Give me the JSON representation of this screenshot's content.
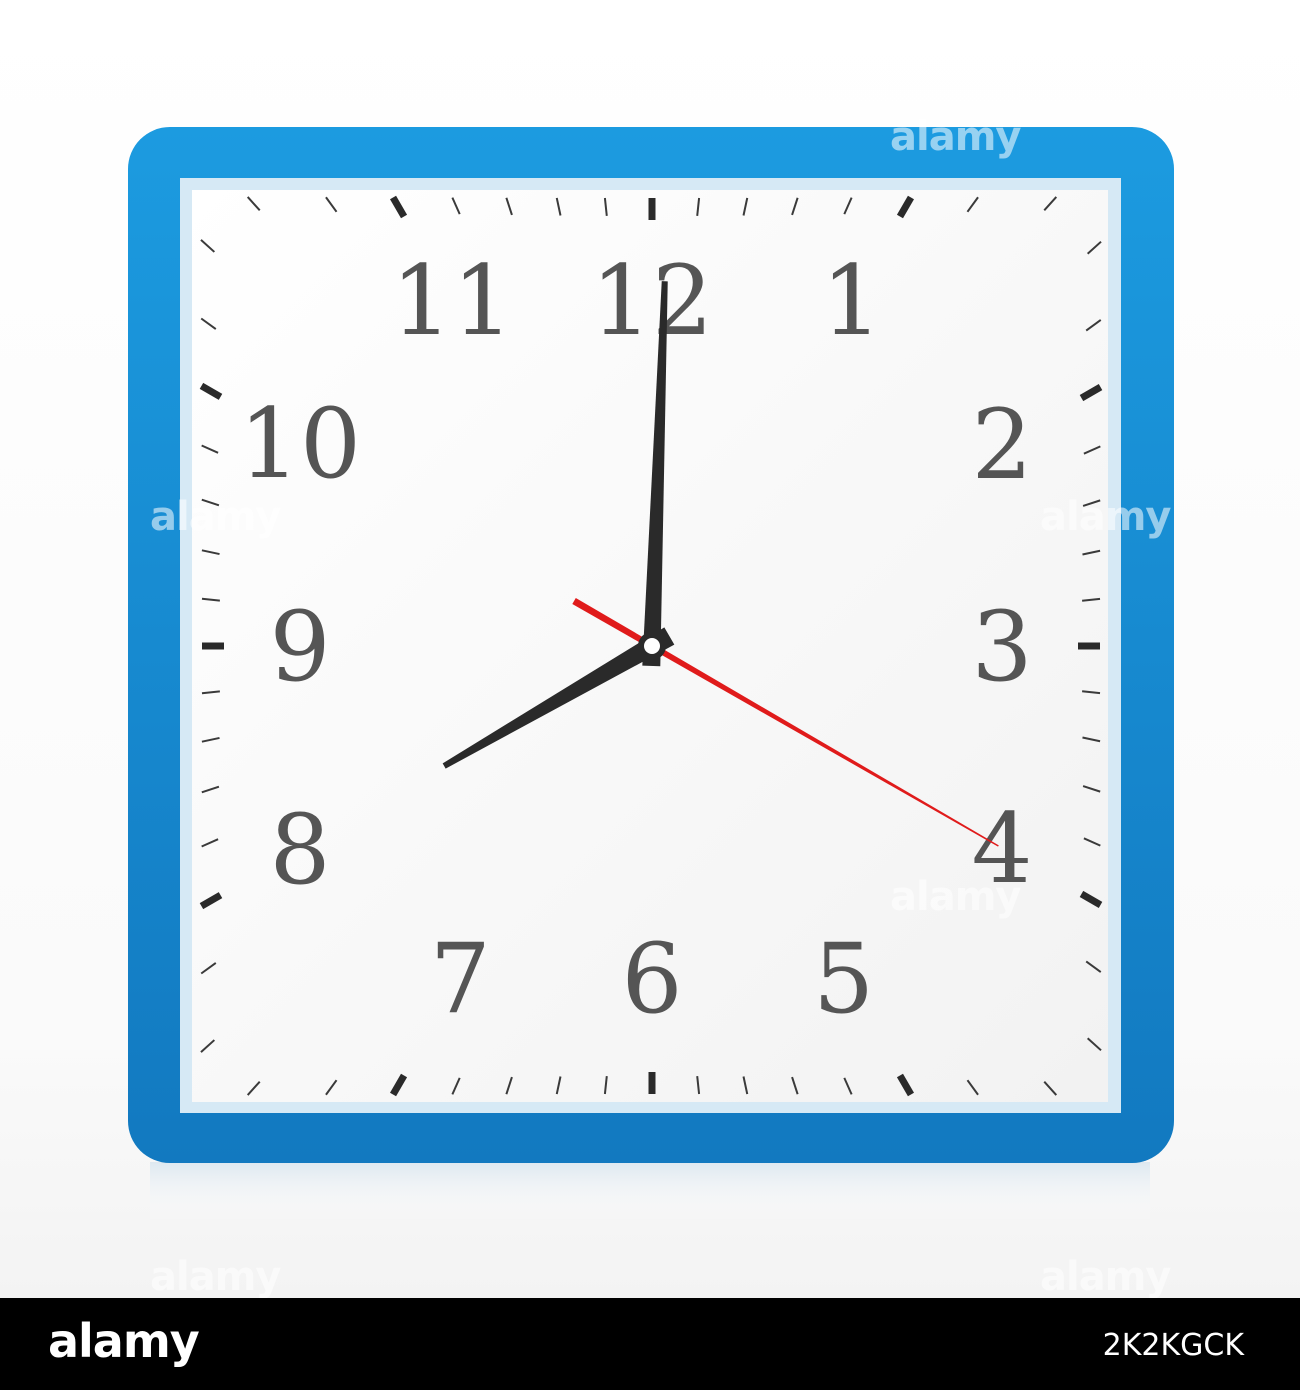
{
  "clock": {
    "numerals": [
      "12",
      "1",
      "2",
      "3",
      "4",
      "5",
      "6",
      "7",
      "8",
      "9",
      "10",
      "11"
    ],
    "time": {
      "hours": 8,
      "minutes": 0,
      "seconds": 20
    },
    "colors": {
      "frame": "#1a8fd6",
      "frame_edge": "#0f6fb0",
      "dial": "#ffffff",
      "numerals": "#555555",
      "hands": "#2a2a2a",
      "second_hand": "#e01b1b"
    }
  },
  "watermark": {
    "text": "alamy"
  },
  "footer": {
    "logo": "alamy",
    "image_id": "2K2KGCK"
  }
}
